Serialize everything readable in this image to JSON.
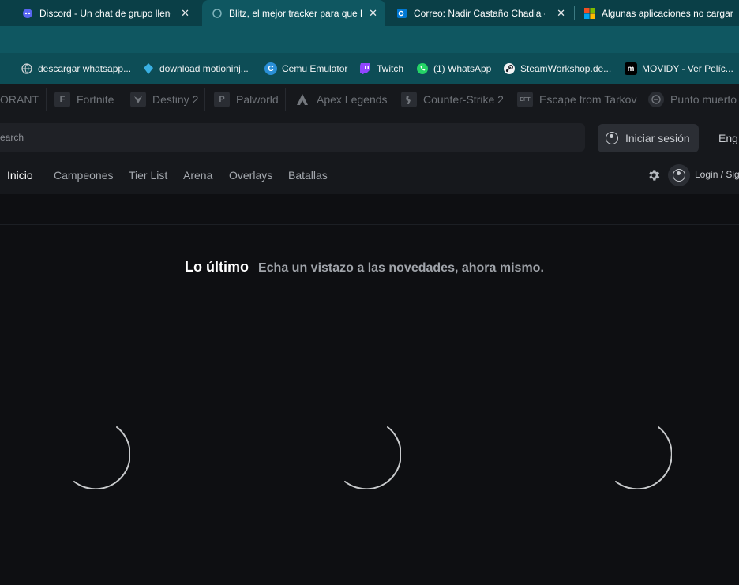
{
  "browser": {
    "tabs": [
      {
        "title": "Discord - Un chat de grupo lleno",
        "icon": "discord-icon",
        "active": false
      },
      {
        "title": "Blitz, el mejor tracker para que l",
        "icon": "blitz-icon",
        "active": true
      },
      {
        "title": "Correo: Nadir Castaño Chadia -",
        "icon": "outlook-icon",
        "active": false
      },
      {
        "title": "Algunas aplicaciones no cargar",
        "icon": "microsoft-icon",
        "active": false
      }
    ],
    "close_glyph": "✕",
    "bookmarks": [
      {
        "label": "descargar whatsapp...",
        "icon": "globe-icon"
      },
      {
        "label": "download motioninj...",
        "icon": "motioninjoy-icon"
      },
      {
        "label": "Cemu Emulator",
        "icon": "cemu-icon"
      },
      {
        "label": "Twitch",
        "icon": "twitch-icon"
      },
      {
        "label": "(1) WhatsApp",
        "icon": "whatsapp-icon"
      },
      {
        "label": "SteamWorkshop.de...",
        "icon": "steam-icon"
      },
      {
        "label": "MOVIDY - Ver Pelíc...",
        "icon": "movidy-icon"
      }
    ]
  },
  "games": [
    {
      "label": "ORANT",
      "icon": ""
    },
    {
      "label": "Fortnite",
      "icon": "fortnite-icon"
    },
    {
      "label": "Destiny 2",
      "icon": "destiny-icon"
    },
    {
      "label": "Palworld",
      "icon": "palworld-icon"
    },
    {
      "label": "Apex Legends",
      "icon": "apex-icon"
    },
    {
      "label": "Counter-Strike 2",
      "icon": "counter-strike-icon"
    },
    {
      "label": "Escape from Tarkov",
      "icon": "tarkov-icon"
    },
    {
      "label": "Punto muerto",
      "icon": "deadlock-icon"
    }
  ],
  "search": {
    "placeholder": "earch"
  },
  "auth": {
    "login_label": "Iniciar sesión",
    "language": "Eng",
    "account_label": "Login / Sig"
  },
  "nav": {
    "items": [
      "Inicio",
      "Campeones",
      "Tier List",
      "Arena",
      "Overlays",
      "Batallas"
    ],
    "active": "Inicio"
  },
  "main": {
    "headline": "Lo último",
    "subheadline": "Echa un vistazo a las novedades, ahora mismo."
  },
  "colors": {
    "tab_bar": "#0a3f47",
    "active_tab": "#0f5761",
    "page_bg": "#0e0f12",
    "header_bg": "#16181c"
  }
}
